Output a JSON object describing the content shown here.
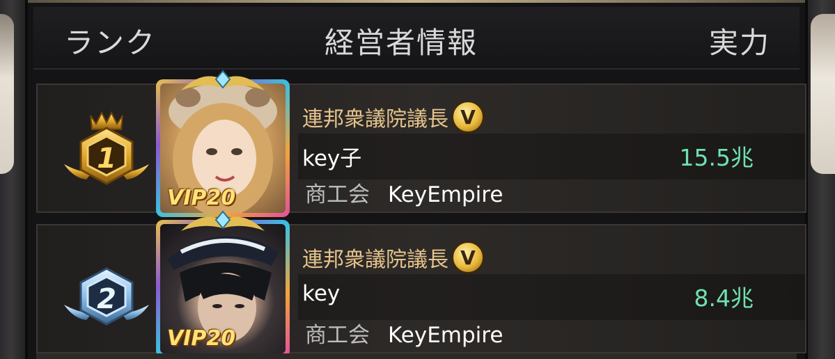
{
  "header": {
    "rank": "ランク",
    "manager_info": "経営者情報",
    "power": "実力"
  },
  "rows": [
    {
      "rank": "1",
      "title": "連邦衆議院議長",
      "v_badge": "V",
      "name": "key子",
      "power": "15.5兆",
      "guild_label": "商工会",
      "guild_name": "KeyEmpire",
      "vip": "VIP20"
    },
    {
      "rank": "2",
      "title": "連邦衆議院議長",
      "v_badge": "V",
      "name": "key",
      "power": "8.4兆",
      "guild_label": "商工会",
      "guild_name": "KeyEmpire",
      "vip": "VIP20"
    }
  ],
  "colors": {
    "title": "#e7c48c",
    "power": "#6fe2b1",
    "gold_badge": "#e1b23a",
    "silver_badge": "#7fb6e6"
  },
  "icons": {
    "rank1": "gold-crown-badge",
    "rank2": "silver-blue-badge",
    "v_mark": "gold-v-coin"
  }
}
